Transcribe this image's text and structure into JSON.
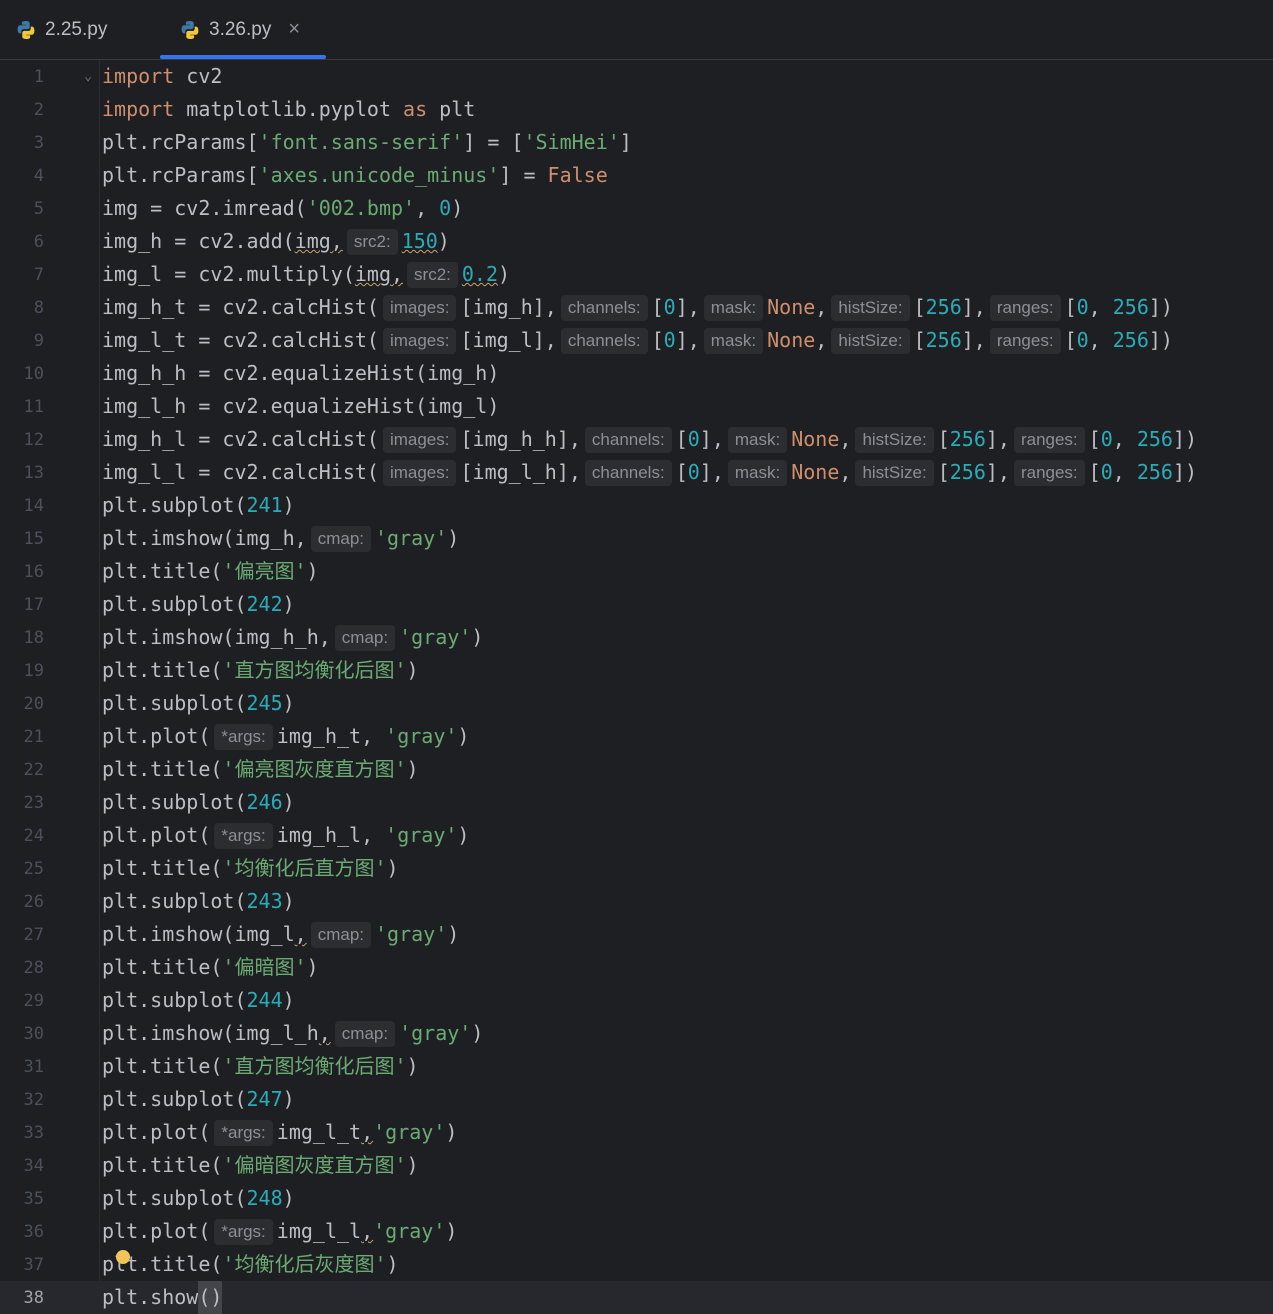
{
  "tabs": [
    {
      "label": "2.25.py",
      "active": false
    },
    {
      "label": "3.26.py",
      "active": true,
      "close": "×"
    }
  ],
  "colors": {
    "background": "#1e1f22",
    "keyword": "#cf8e6d",
    "string": "#6aab73",
    "number": "#2aacb8",
    "accent": "#3574f0"
  },
  "editor": {
    "current_line": 38,
    "lines": [
      [
        [
          "kw",
          "import"
        ],
        [
          "t",
          " cv2"
        ]
      ],
      [
        [
          "kw",
          "import"
        ],
        [
          "t",
          " matplotlib.pyplot "
        ],
        [
          "kw",
          "as"
        ],
        [
          "t",
          " plt"
        ]
      ],
      [
        [
          "t",
          "plt.rcParams["
        ],
        [
          "str",
          "'font.sans-serif'"
        ],
        [
          "t",
          "] = ["
        ],
        [
          "str",
          "'SimHei'"
        ],
        [
          "t",
          "]"
        ]
      ],
      [
        [
          "t",
          "plt.rcParams["
        ],
        [
          "str",
          "'axes.unicode_minus'"
        ],
        [
          "t",
          "] = "
        ],
        [
          "kw",
          "False"
        ]
      ],
      [
        [
          "t",
          "img = cv2.imread("
        ],
        [
          "str",
          "'002.bmp'"
        ],
        [
          "t",
          ", "
        ],
        [
          "num",
          "0"
        ],
        [
          "t",
          ")"
        ]
      ],
      [
        [
          "t",
          "img_h = cv2.add("
        ],
        [
          "w",
          "img,"
        ],
        [
          "h",
          "src2:"
        ],
        [
          "wn",
          "150"
        ],
        [
          "t",
          ")"
        ]
      ],
      [
        [
          "t",
          "img_l = cv2.multiply("
        ],
        [
          "w",
          "img,"
        ],
        [
          "h",
          "src2:"
        ],
        [
          "wn",
          "0.2"
        ],
        [
          "t",
          ")"
        ]
      ],
      [
        [
          "t",
          "img_h_t = cv2.calcHist("
        ],
        [
          "h",
          "images:"
        ],
        [
          "t",
          "[img_h],"
        ],
        [
          "h",
          "channels:"
        ],
        [
          "t",
          "["
        ],
        [
          "num",
          "0"
        ],
        [
          "t",
          "],"
        ],
        [
          "h",
          "mask:"
        ],
        [
          "kw",
          "None"
        ],
        [
          "t",
          ","
        ],
        [
          "h",
          "histSize:"
        ],
        [
          "t",
          "["
        ],
        [
          "num",
          "256"
        ],
        [
          "t",
          "],"
        ],
        [
          "h",
          "ranges:"
        ],
        [
          "t",
          "["
        ],
        [
          "num",
          "0"
        ],
        [
          "t",
          ", "
        ],
        [
          "num",
          "256"
        ],
        [
          "t",
          "])"
        ]
      ],
      [
        [
          "t",
          "img_l_t = cv2.calcHist("
        ],
        [
          "h",
          "images:"
        ],
        [
          "t",
          "[img_l],"
        ],
        [
          "h",
          "channels:"
        ],
        [
          "t",
          "["
        ],
        [
          "num",
          "0"
        ],
        [
          "t",
          "],"
        ],
        [
          "h",
          "mask:"
        ],
        [
          "kw",
          "None"
        ],
        [
          "t",
          ","
        ],
        [
          "h",
          "histSize:"
        ],
        [
          "t",
          "["
        ],
        [
          "num",
          "256"
        ],
        [
          "t",
          "],"
        ],
        [
          "h",
          "ranges:"
        ],
        [
          "t",
          "["
        ],
        [
          "num",
          "0"
        ],
        [
          "t",
          ", "
        ],
        [
          "num",
          "256"
        ],
        [
          "t",
          "])"
        ]
      ],
      [
        [
          "t",
          "img_h_h = cv2.equalizeHist(img_h)"
        ]
      ],
      [
        [
          "t",
          "img_l_h = cv2.equalizeHist(img_l)"
        ]
      ],
      [
        [
          "t",
          "img_h_l = cv2.calcHist("
        ],
        [
          "h",
          "images:"
        ],
        [
          "t",
          "[img_h_h],"
        ],
        [
          "h",
          "channels:"
        ],
        [
          "t",
          "["
        ],
        [
          "num",
          "0"
        ],
        [
          "t",
          "],"
        ],
        [
          "h",
          "mask:"
        ],
        [
          "kw",
          "None"
        ],
        [
          "t",
          ","
        ],
        [
          "h",
          "histSize:"
        ],
        [
          "t",
          "["
        ],
        [
          "num",
          "256"
        ],
        [
          "t",
          "],"
        ],
        [
          "h",
          "ranges:"
        ],
        [
          "t",
          "["
        ],
        [
          "num",
          "0"
        ],
        [
          "t",
          ", "
        ],
        [
          "num",
          "256"
        ],
        [
          "t",
          "])"
        ]
      ],
      [
        [
          "t",
          "img_l_l = cv2.calcHist("
        ],
        [
          "h",
          "images:"
        ],
        [
          "t",
          "[img_l_h],"
        ],
        [
          "h",
          "channels:"
        ],
        [
          "t",
          "["
        ],
        [
          "num",
          "0"
        ],
        [
          "t",
          "],"
        ],
        [
          "h",
          "mask:"
        ],
        [
          "kw",
          "None"
        ],
        [
          "t",
          ","
        ],
        [
          "h",
          "histSize:"
        ],
        [
          "t",
          "["
        ],
        [
          "num",
          "256"
        ],
        [
          "t",
          "],"
        ],
        [
          "h",
          "ranges:"
        ],
        [
          "t",
          "["
        ],
        [
          "num",
          "0"
        ],
        [
          "t",
          ", "
        ],
        [
          "num",
          "256"
        ],
        [
          "t",
          "])"
        ]
      ],
      [
        [
          "t",
          "plt.subplot("
        ],
        [
          "num",
          "241"
        ],
        [
          "t",
          ")"
        ]
      ],
      [
        [
          "t",
          "plt.imshow(img_h,"
        ],
        [
          "h",
          "cmap:"
        ],
        [
          "str",
          "'gray'"
        ],
        [
          "t",
          ")"
        ]
      ],
      [
        [
          "t",
          "plt.title("
        ],
        [
          "str",
          "'偏亮图'"
        ],
        [
          "t",
          ")"
        ]
      ],
      [
        [
          "t",
          "plt.subplot("
        ],
        [
          "num",
          "242"
        ],
        [
          "t",
          ")"
        ]
      ],
      [
        [
          "t",
          "plt.imshow(img_h_h,"
        ],
        [
          "h",
          "cmap:"
        ],
        [
          "str",
          "'gray'"
        ],
        [
          "t",
          ")"
        ]
      ],
      [
        [
          "t",
          "plt.title("
        ],
        [
          "str",
          "'直方图均衡化后图'"
        ],
        [
          "t",
          ")"
        ]
      ],
      [
        [
          "t",
          "plt.subplot("
        ],
        [
          "num",
          "245"
        ],
        [
          "t",
          ")"
        ]
      ],
      [
        [
          "t",
          "plt.plot("
        ],
        [
          "h",
          "*args:"
        ],
        [
          "t",
          "img_h_t, "
        ],
        [
          "str",
          "'gray'"
        ],
        [
          "t",
          ")"
        ]
      ],
      [
        [
          "t",
          "plt.title("
        ],
        [
          "str",
          "'偏亮图灰度直方图'"
        ],
        [
          "t",
          ")"
        ]
      ],
      [
        [
          "t",
          "plt.subplot("
        ],
        [
          "num",
          "246"
        ],
        [
          "t",
          ")"
        ]
      ],
      [
        [
          "t",
          "plt.plot("
        ],
        [
          "h",
          "*args:"
        ],
        [
          "t",
          "img_h_l, "
        ],
        [
          "str",
          "'gray'"
        ],
        [
          "t",
          ")"
        ]
      ],
      [
        [
          "t",
          "plt.title("
        ],
        [
          "str",
          "'均衡化后直方图'"
        ],
        [
          "t",
          ")"
        ]
      ],
      [
        [
          "t",
          "plt.subplot("
        ],
        [
          "num",
          "243"
        ],
        [
          "t",
          ")"
        ]
      ],
      [
        [
          "t",
          "plt.imshow(img_l"
        ],
        [
          "w",
          ","
        ],
        [
          "h",
          "cmap:"
        ],
        [
          "str",
          "'gray'"
        ],
        [
          "t",
          ")"
        ]
      ],
      [
        [
          "t",
          "plt.title("
        ],
        [
          "str",
          "'偏暗图'"
        ],
        [
          "t",
          ")"
        ]
      ],
      [
        [
          "t",
          "plt.subplot("
        ],
        [
          "num",
          "244"
        ],
        [
          "t",
          ")"
        ]
      ],
      [
        [
          "t",
          "plt.imshow(img_l_h"
        ],
        [
          "w",
          ","
        ],
        [
          "h",
          "cmap:"
        ],
        [
          "str",
          "'gray'"
        ],
        [
          "t",
          ")"
        ]
      ],
      [
        [
          "t",
          "plt.title("
        ],
        [
          "str",
          "'直方图均衡化后图'"
        ],
        [
          "t",
          ")"
        ]
      ],
      [
        [
          "t",
          "plt.subplot("
        ],
        [
          "num",
          "247"
        ],
        [
          "t",
          ")"
        ]
      ],
      [
        [
          "t",
          "plt.plot("
        ],
        [
          "h",
          "*args:"
        ],
        [
          "t",
          "img_l_t"
        ],
        [
          "w",
          ","
        ],
        [
          "str",
          "'gray'"
        ],
        [
          "t",
          ")"
        ]
      ],
      [
        [
          "t",
          "plt.title("
        ],
        [
          "str",
          "'偏暗图灰度直方图'"
        ],
        [
          "t",
          ")"
        ]
      ],
      [
        [
          "t",
          "plt.subplot("
        ],
        [
          "num",
          "248"
        ],
        [
          "t",
          ")"
        ]
      ],
      [
        [
          "t",
          "plt.plot("
        ],
        [
          "h",
          "*args:"
        ],
        [
          "t",
          "img_l_l"
        ],
        [
          "w",
          ","
        ],
        [
          "str",
          "'gray'"
        ],
        [
          "t",
          ")"
        ]
      ],
      [
        [
          "t",
          "plt.title("
        ],
        [
          "str",
          "'均衡化后灰度图'"
        ],
        [
          "t",
          ")"
        ]
      ],
      [
        [
          "t",
          "plt.show"
        ],
        [
          "c",
          "()"
        ]
      ]
    ]
  }
}
